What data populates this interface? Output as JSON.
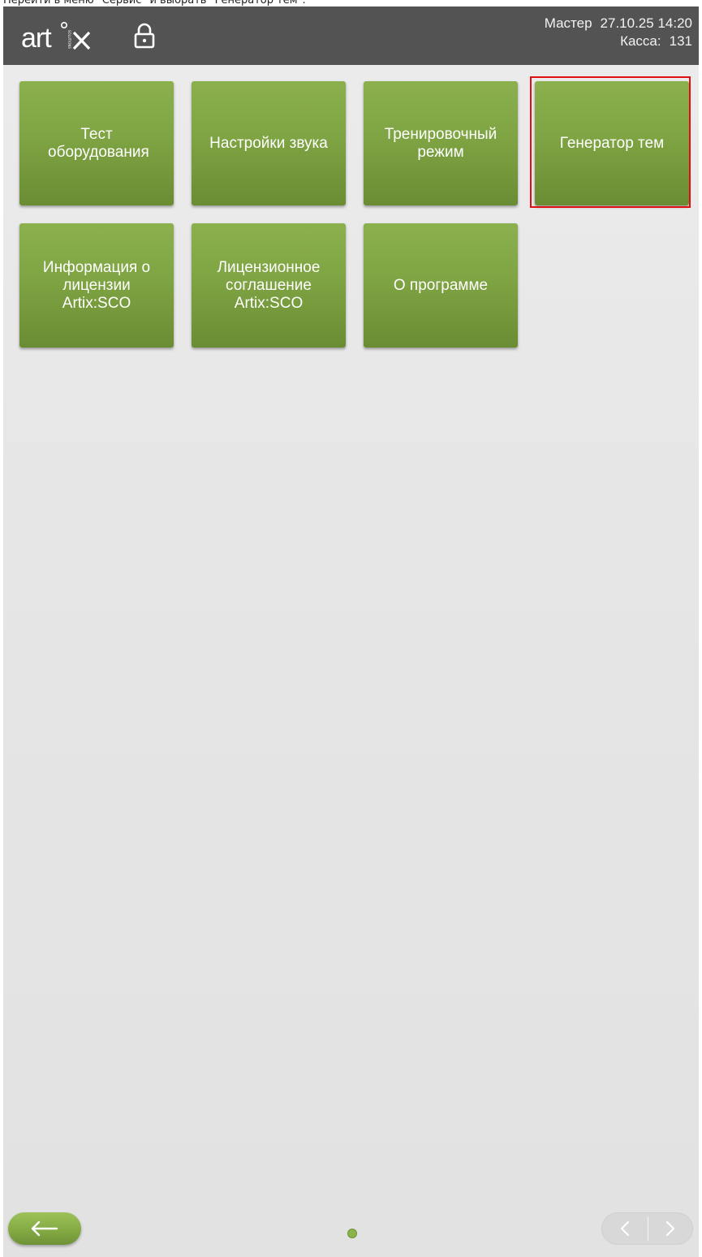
{
  "caption": "Перейти в меню \"Сервис\" и выбрать \"Генератор тем\".",
  "header": {
    "logo_text": "artx",
    "logo_sub": "SOLUTIONS",
    "user": "Мастер",
    "datetime": "27.10.25 14:20",
    "register_label": "Касса:",
    "register_number": "131"
  },
  "tiles": [
    {
      "label": "Тест оборудования"
    },
    {
      "label": "Настройки звука"
    },
    {
      "label": "Тренировочный режим"
    },
    {
      "label": "Генератор тем",
      "highlighted": true
    },
    {
      "label": "Информация о лицензии Artix:SCO"
    },
    {
      "label": "Лицензионное соглашение Artix:SCO"
    },
    {
      "label": "О программе"
    }
  ],
  "footer": {
    "back_icon": "arrow-left-icon",
    "page_indicator_current": 1,
    "prev_icon": "chevron-left-icon",
    "next_icon": "chevron-right-icon"
  },
  "colors": {
    "accent_green": "#7fa443",
    "topbar": "#535353",
    "highlight_border": "#e01010"
  }
}
